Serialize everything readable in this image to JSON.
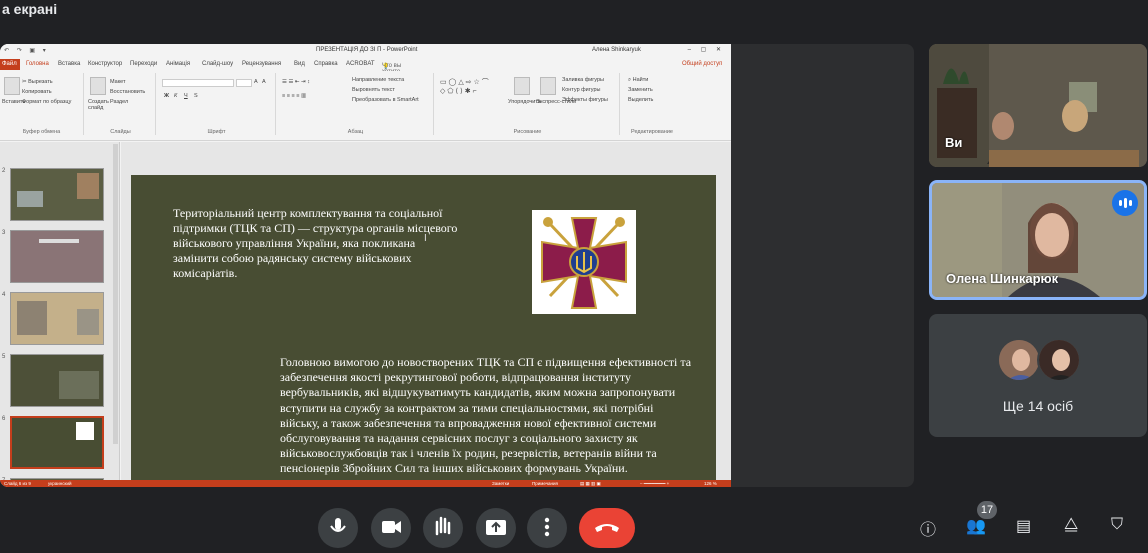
{
  "header": {
    "presenting_label": "а екрані"
  },
  "powerpoint": {
    "window_title": "ПРЕЗЕНТАЦІЯ ДО ЗІ П - PowerPoint",
    "user": "Алена Shinkaryuk",
    "tabs": [
      "Файл",
      "Головна",
      "Вставка",
      "Конструктор",
      "Переходи",
      "Анімація",
      "Слайд-шоу",
      "Рецензування",
      "Вид",
      "Справка",
      "ACROBAT"
    ],
    "tell_me": "Что вы хотите сделать?",
    "share": "Общий доступ",
    "ribbon": {
      "clipboard": {
        "label": "Буфер обмена",
        "paste": "Вставить",
        "cut": "Вырезать",
        "copy": "Копировать",
        "format": "Формат по образцу"
      },
      "slides": {
        "label": "Слайды",
        "create": "Создать слайд",
        "layout": "Макет",
        "reset": "Восстановить",
        "section": "Раздел"
      },
      "font": {
        "label": "Шрифт",
        "bold": "Ж",
        "italic": "К",
        "underline": "Ч",
        "strike": "S",
        "size_up": "A",
        "size_down": "A"
      },
      "paragraph": {
        "label": "Абзац",
        "direction": "Направление текста",
        "align": "Выровнять текст",
        "smartart": "Преобразовать в SmartArt"
      },
      "drawing": {
        "label": "Рисование",
        "arrange": "Упорядочить",
        "styles": "Экспресс-стили",
        "fill": "Заливка фигуры",
        "outline": "Контур фигуры",
        "effects": "Эффекты фигуры"
      },
      "editing": {
        "label": "Редактирование",
        "find": "Найти",
        "replace": "Заменить",
        "select": "Выделить"
      }
    },
    "slide_numbers": [
      "2",
      "3",
      "4",
      "5",
      "6",
      "7"
    ],
    "slide": {
      "text_top": "Територіальний центр комплектування та соціальної підтримки (ТЦК та СП) — структура органів місцевого військового управління України, яка покликана замінити собою радянську систему військових комісаріатів.",
      "text_bottom": "Головною вимогою до новостворених ТЦК та СП є підвищення ефективності та забезпечення якості рекрутингової роботи, відпрацювання інституту вербувальників, які відшукуватимуть кандидатів, яким можна запропонувати вступити на службу за контрактом за тими спеціальностями, які потрібні війську, а також забезпечення та впровадження нової ефективної системи обслуговування та надання сервісних послуг з соціального захисту як військовослужбовців так і членів їх родин, резервістів, ветеранів війни та пенсіонерів Збройних Сил та інших військових формувань України.",
      "cursor": "I"
    },
    "status": {
      "slide": "Слайд 6 из 9",
      "lang": "украинский",
      "notes": "Заметки",
      "comments": "Примечания",
      "zoom": "126 %"
    }
  },
  "participants": {
    "tile1_name": "Ви",
    "tile2_name": "Олена Шинкарюк",
    "more_label": "Ще 14 осіб"
  },
  "controls": {
    "mic_icon": "mic-icon",
    "camera_icon": "camera-icon",
    "hand_icon": "raise-hand-icon",
    "present_icon": "present-icon",
    "more_icon": "more-options-icon",
    "end_icon": "end-call-icon",
    "people_count": "17"
  },
  "colors": {
    "meet_bg": "#202124",
    "slide_bg": "#484d33",
    "ppt_accent": "#c43e1c",
    "end_call": "#ea4335",
    "active_speaker": "#8ab4f8"
  }
}
